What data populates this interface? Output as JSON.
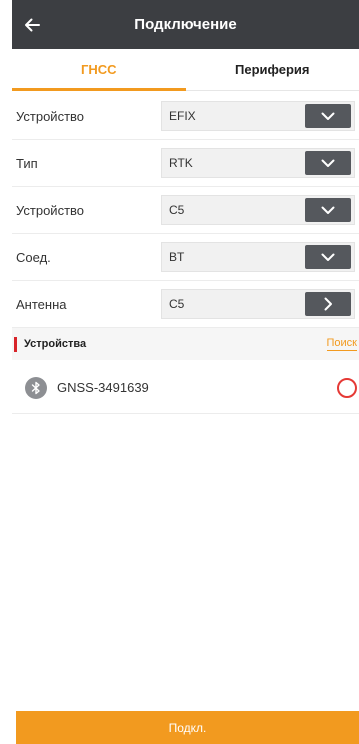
{
  "header": {
    "title": "Подключение",
    "back_icon": "arrow-left-icon"
  },
  "tabs": [
    {
      "label": "ГНСС",
      "active": true
    },
    {
      "label": "Периферия",
      "active": false
    }
  ],
  "form": {
    "rows": [
      {
        "label": "Устройство",
        "value": "EFIX",
        "icon": "chevron-down-icon"
      },
      {
        "label": "Тип",
        "value": "RTK",
        "icon": "chevron-down-icon"
      },
      {
        "label": "Устройство",
        "value": "C5",
        "icon": "chevron-down-icon"
      },
      {
        "label": "Соед.",
        "value": "BT",
        "icon": "chevron-down-icon"
      },
      {
        "label": "Антенна",
        "value": "C5",
        "icon": "chevron-right-icon"
      }
    ]
  },
  "devices_section": {
    "title": "Устройства",
    "search_label": "Поиск"
  },
  "devices": [
    {
      "name": "GNSS-3491639",
      "icon": "bluetooth-icon",
      "selected": false
    }
  ],
  "connect_button": {
    "label": "Подкл."
  },
  "colors": {
    "accent": "#f29a1f",
    "header_bg": "#3c3e42",
    "section_marker": "#d8242a",
    "radio_border": "#e53935"
  }
}
